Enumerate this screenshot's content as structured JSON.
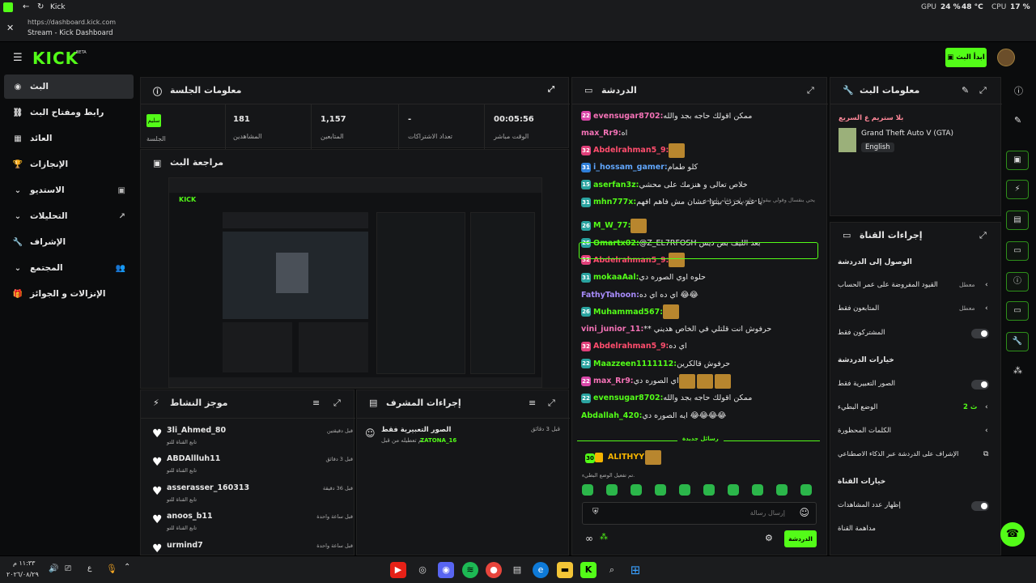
{
  "browser": {
    "tab_title": "Kick",
    "url": "https://dashboard.kick.com",
    "page_title": "Stream - Kick Dashboard",
    "gpu_label": "GPU",
    "gpu_value": "24 %",
    "gpu_temp": "48 °C",
    "cpu_label": "CPU",
    "cpu_value": "17 %"
  },
  "header": {
    "logo": "KICK",
    "beta": "BETA",
    "go_live": "ابدأ البث"
  },
  "sidebar": {
    "items": [
      {
        "label": "البث",
        "icon": "◉"
      },
      {
        "label": "رابط ومفتاح البث",
        "icon": "⛓"
      },
      {
        "label": "العائد",
        "icon": "▦"
      },
      {
        "label": "الإنجازات",
        "icon": "🏆"
      },
      {
        "label": "الاستديو",
        "icon": "▣"
      },
      {
        "label": "التحليلات",
        "icon": "↗"
      },
      {
        "label": "الإشراف",
        "icon": "🔧"
      },
      {
        "label": "المجتمع",
        "icon": "👥"
      },
      {
        "label": "الإنزالات و الجوائز",
        "icon": "🎁"
      }
    ]
  },
  "session": {
    "title": "معلومات الجلسة",
    "status": "سليم",
    "status_label": "الجلسة",
    "stats": [
      {
        "value": "181",
        "label": "المشاهدين"
      },
      {
        "value": "1,157",
        "label": "المتابعين"
      },
      {
        "value": "-",
        "label": "تعداد الاشتراكات"
      },
      {
        "value": "00:05:56",
        "label": "الوقت مباشر"
      }
    ]
  },
  "preview": {
    "title": "مراجعة البث"
  },
  "activity": {
    "title": "موجز النشاط",
    "items": [
      {
        "user": "3li_Ahmed_80",
        "action": "تابع القناة للتو",
        "time": "قبل دقيقتين"
      },
      {
        "user": "ABDAllluh11",
        "action": "تابع القناة للتو",
        "time": "قبل 3 دقائق"
      },
      {
        "user": "asserasser_160313",
        "action": "تابع القناة للتو",
        "time": "قبل 36 دقيقة"
      },
      {
        "user": "anoos_b11",
        "action": "تابع القناة للتو",
        "time": "قبل ساعة واحدة"
      },
      {
        "user": "urmind7",
        "action": "",
        "time": "قبل ساعة واحدة"
      }
    ]
  },
  "modactions": {
    "title": "إجراءات المشرف",
    "item_title": "الصور التعبيرية فقط",
    "item_desc": "تم تعطيله من قبل",
    "item_user": "ZATONA_16",
    "item_time": "قبل 3 دقائق"
  },
  "chat": {
    "title": "الدردشة",
    "pinned_note": "يحي بنقسال وقولي بيقول مجلس انت فقلم يامحمد",
    "lines": [
      {
        "badge": "22",
        "color": "#f472b6",
        "user": "evensugar8702",
        "msg": "ممكن اقولك حاجه بجد والله",
        "emotes": 0
      },
      {
        "badge": "",
        "color": "#f472b6",
        "user": "max_Rr9",
        "msg": "اه",
        "emotes": 0
      },
      {
        "badge": "32",
        "color": "#ff4d6d",
        "user": "Abdelrahman5_9",
        "msg": "",
        "emotes": 1
      },
      {
        "badge": "31",
        "color": "#60a5fa",
        "user": "i_hossam_gamer",
        "msg": "كلو طمام",
        "emotes": 0
      },
      {
        "badge": "15",
        "color": "#53fc18",
        "user": "aserfan3z",
        "msg": "خلاص تعالى و هنزمك على محشي",
        "emotes": 0
      },
      {
        "badge": "31",
        "color": "#53fc18",
        "user": "mhn777x",
        "msg": "يا عم يخرب بيتوا عشان مش فاهم افهم",
        "emotes": 0
      },
      {
        "badge": "26",
        "color": "#53fc18",
        "user": "M_W_77",
        "msg": "",
        "emotes": 1
      },
      {
        "badge": "26",
        "color": "#53fc18",
        "user": "Omartx02",
        "msg": "@Z_EL7RFOSH بعد الليف بص ديس",
        "emotes": 0
      },
      {
        "badge": "32",
        "color": "#ff4d6d",
        "user": "Abdelrahman5_9",
        "msg": "",
        "emotes": 1
      },
      {
        "badge": "31",
        "color": "#53fc18",
        "user": "mokaaAal",
        "msg": "حلوه اوي الصوره دي",
        "emotes": 0
      },
      {
        "badge": "",
        "color": "#a78bfa",
        "user": "FathyTahoon",
        "msg": "اي ده اي ده 😂😂",
        "emotes": 0
      },
      {
        "badge": "26",
        "color": "#53fc18",
        "user": "Muhammad567",
        "msg": "",
        "emotes": 1
      },
      {
        "badge": "",
        "color": "#f472b6",
        "user": "vini_junior_11",
        "msg": "** حرفوش انت قلتلي في الخاص هديني",
        "emotes": 0
      },
      {
        "badge": "32",
        "color": "#ff4d6d",
        "user": "Abdelrahman5_9",
        "msg": "اي ده",
        "emotes": 0
      },
      {
        "badge": "22",
        "color": "#53fc18",
        "user": "Maazzeen1111112",
        "msg": "حرفوش قالكرين",
        "emotes": 0
      },
      {
        "badge": "22",
        "color": "#f472b6",
        "user": "max_Rr9",
        "msg": "اي الصوره دي",
        "emotes": 3
      },
      {
        "badge": "22",
        "color": "#53fc18",
        "user": "evensugar8702",
        "msg": "ممكن اقولك حاجه بجد والله",
        "emotes": 0
      },
      {
        "badge": "",
        "color": "#53fc18",
        "user": "Abdallah_420",
        "msg": "ايه الصوره دي 😂😂😂😂",
        "emotes": 0
      }
    ],
    "new_messages": "رسائل جديدة",
    "last_user": "ALITHYY",
    "last_badge": "30",
    "slow_mode": "تم تفعيل الوضع البطيء.",
    "input_placeholder": "إرسال رسالة",
    "send": "الدردشة"
  },
  "streaminfo": {
    "title": "معلومات البث",
    "stream_title": "بلا ستريم ع السريع",
    "game": "Grand Theft Auto V (GTA)",
    "language": "English"
  },
  "channelactions": {
    "title": "إجراءات القناة",
    "sections": {
      "access": "الوصول إلى الدردشة",
      "options": "خيارات الدردشة",
      "channel": "خيارات القناة"
    },
    "rows": {
      "age": "القيود المفروضة على عمر الحساب",
      "age_val": "معطل",
      "followers": "المتابعون فقط",
      "followers_val": "معطل",
      "subs": "المشتركون فقط",
      "emotes": "الصور التعبيرية فقط",
      "slow": "الوضع البطيء",
      "slow_val": "ث 2",
      "banned": "الكلمات المحظورة",
      "ai": "الإشراف على الدردشة عبر الذكاء الاصطناعي",
      "viewers": "إظهار عدد المشاهدات",
      "host": "مداهمة القناة"
    }
  },
  "taskbar": {
    "time": "١١:٣٣ م",
    "date": "٢٠٢٦/٠٨/٢٩",
    "lang": "ع"
  },
  "colors": {
    "accent": "#53fc18",
    "panel": "#151618",
    "bg": "#0b0c0d"
  }
}
